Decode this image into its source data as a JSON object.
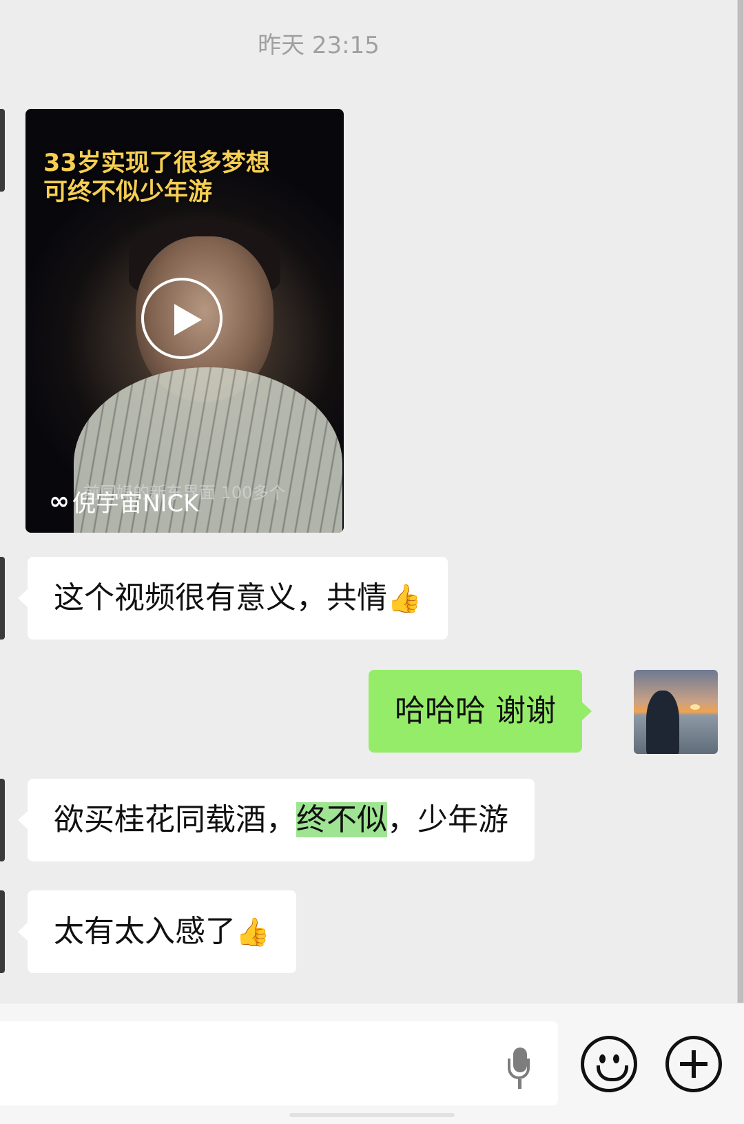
{
  "chat": {
    "timestamp": "昨天 23:15",
    "video": {
      "title_line1": "33岁实现了很多梦想",
      "title_line2": "可终不似少年游",
      "subtitle_overlay": "前同媒的新东界面 100多个",
      "channel_logo": "∞",
      "channel_name": "倪宇宙NICK"
    },
    "messages": [
      {
        "side": "in",
        "text": "这个视频很有意义，共情",
        "emoji": "👍"
      },
      {
        "side": "out",
        "text": "哈哈哈 谢谢"
      },
      {
        "side": "in",
        "text_before": "欲买桂花同载酒，",
        "text_highlight": "终不似",
        "text_after": "，少年游"
      },
      {
        "side": "in",
        "text": "太有太入感了",
        "emoji": "👍"
      }
    ]
  },
  "input_bar": {
    "voice_icon": "microphone-icon",
    "emoji_icon": "smiley-icon",
    "more_icon": "plus-circle-icon"
  },
  "colors": {
    "background": "#ededed",
    "incoming_bubble": "#ffffff",
    "outgoing_bubble": "#95ec69",
    "highlight": "#9fe493",
    "video_title": "#f6cf52"
  }
}
